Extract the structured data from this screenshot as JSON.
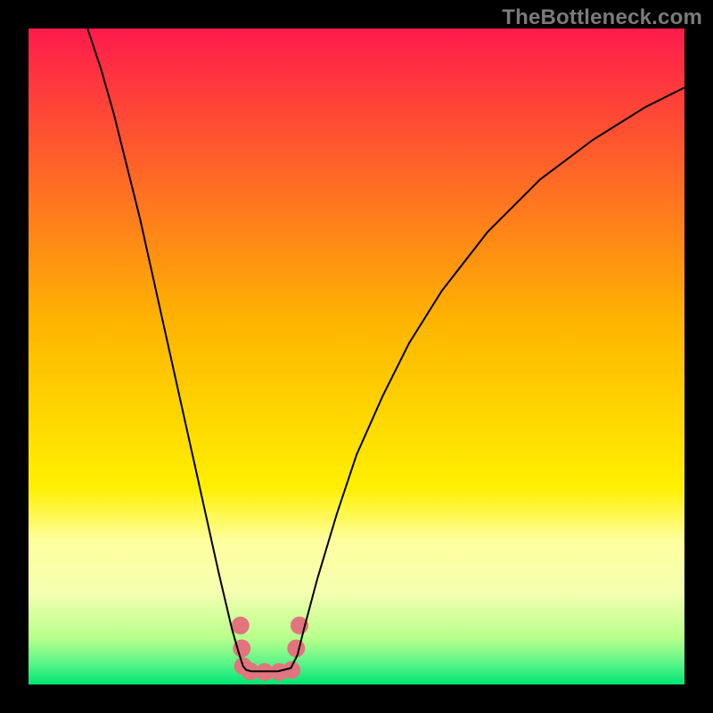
{
  "watermark": "TheBottleneck.com",
  "chart_data": {
    "type": "line",
    "title": "",
    "xlabel": "",
    "ylabel": "",
    "xlim": [
      0,
      1
    ],
    "ylim": [
      0,
      1
    ],
    "grid": false,
    "legend": false,
    "annotations": [],
    "background": {
      "type": "vertical-gradient",
      "stops": [
        {
          "offset": 0.0,
          "color": "#ff1b4c"
        },
        {
          "offset": 0.45,
          "color": "#ffb500"
        },
        {
          "offset": 0.7,
          "color": "#fff000"
        },
        {
          "offset": 0.78,
          "color": "#ffff9e"
        },
        {
          "offset": 0.86,
          "color": "#f4ffb0"
        },
        {
          "offset": 0.93,
          "color": "#b6ff8a"
        },
        {
          "offset": 0.97,
          "color": "#55f489"
        },
        {
          "offset": 1.0,
          "color": "#00e571"
        }
      ]
    },
    "series": [
      {
        "name": "curve",
        "color": "#000000",
        "width": 2,
        "x": [
          0.09,
          0.11,
          0.13,
          0.15,
          0.17,
          0.19,
          0.21,
          0.23,
          0.25,
          0.27,
          0.29,
          0.31,
          0.32,
          0.327,
          0.332,
          0.34,
          0.355,
          0.38,
          0.4,
          0.41,
          0.42,
          0.44,
          0.47,
          0.5,
          0.54,
          0.58,
          0.63,
          0.7,
          0.78,
          0.86,
          0.94,
          1.0
        ],
        "y": [
          1.0,
          0.94,
          0.87,
          0.79,
          0.71,
          0.62,
          0.53,
          0.44,
          0.35,
          0.26,
          0.17,
          0.085,
          0.05,
          0.028,
          0.022,
          0.02,
          0.02,
          0.02,
          0.025,
          0.045,
          0.085,
          0.16,
          0.26,
          0.35,
          0.44,
          0.52,
          0.6,
          0.69,
          0.77,
          0.83,
          0.88,
          0.91
        ]
      }
    ],
    "markers": {
      "name": "highlight",
      "color": "#e2747e",
      "radius_px": 10,
      "points": [
        {
          "x": 0.323,
          "y": 0.09
        },
        {
          "x": 0.325,
          "y": 0.055
        },
        {
          "x": 0.327,
          "y": 0.028
        },
        {
          "x": 0.338,
          "y": 0.02
        },
        {
          "x": 0.36,
          "y": 0.019
        },
        {
          "x": 0.382,
          "y": 0.019
        },
        {
          "x": 0.401,
          "y": 0.022
        },
        {
          "x": 0.408,
          "y": 0.055
        },
        {
          "x": 0.413,
          "y": 0.09
        }
      ]
    }
  }
}
